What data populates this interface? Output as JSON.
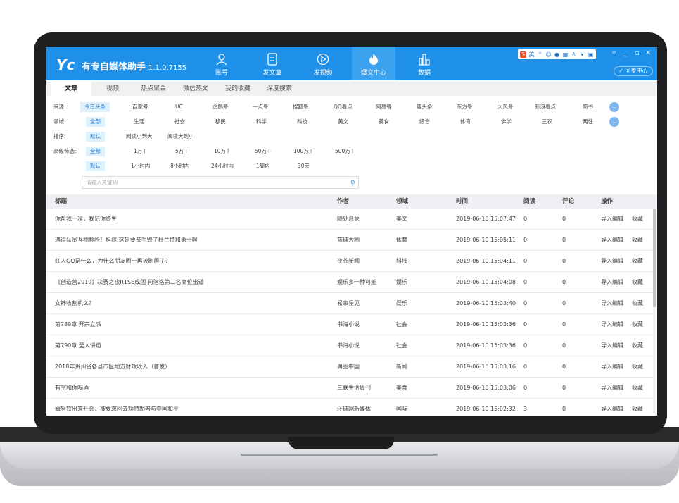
{
  "app": {
    "logo": "Yc",
    "title": "有专自媒体助手",
    "version": "1.1.0.7155",
    "sync_label": "同步中心"
  },
  "nav": [
    {
      "label": "账号",
      "icon": "user-icon"
    },
    {
      "label": "发文章",
      "icon": "document-icon"
    },
    {
      "label": "发视频",
      "icon": "play-icon"
    },
    {
      "label": "爆文中心",
      "icon": "flame-icon",
      "active": true
    },
    {
      "label": "数据",
      "icon": "bar-chart-icon"
    }
  ],
  "toolbar": {
    "ime": "S",
    "ime_mode": "英"
  },
  "tabs": [
    "文章",
    "视频",
    "热点聚合",
    "微信热文",
    "我的收藏",
    "深度搜索"
  ],
  "filters": {
    "source_label": "来源:",
    "sources": [
      "今日头条",
      "百家号",
      "UC",
      "企鹅号",
      "一点号",
      "搜狐号",
      "QQ看点",
      "网易号",
      "趣头条",
      "东方号",
      "大风号",
      "新浪看点",
      "简书"
    ],
    "field_label": "领域:",
    "fields": [
      "全部",
      "生活",
      "社会",
      "移民",
      "科学",
      "科技",
      "美文",
      "美食",
      "综合",
      "体育",
      "佛学",
      "三农",
      "两性"
    ],
    "sort_label": "排序:",
    "sorts": [
      "默认",
      "阅读小到大",
      "阅读大到小"
    ],
    "advanced_label": "高级筛选:",
    "reads": [
      "全部",
      "1万+",
      "5万+",
      "10万+",
      "50万+",
      "100万+",
      "500万+"
    ],
    "times": [
      "默认",
      "1小时内",
      "8小时内",
      "24小时内",
      "1周内",
      "30天"
    ],
    "search_placeholder": "请输入关键词"
  },
  "table": {
    "headers": {
      "title": "标题",
      "author": "作者",
      "field": "领域",
      "time": "时间",
      "reads": "阅读",
      "comments": "评论",
      "actions": "操作"
    },
    "rows": [
      {
        "title": "你帮我一次，我记你终生",
        "author": "随处悬象",
        "field": "美文",
        "time": "2019-06-10 15:07:47",
        "reads": "0",
        "comments": "0"
      },
      {
        "title": "遇得队员互相翻脸！科尔:这是要亲手毁了杜兰特和勇士啊",
        "author": "篮球大圈",
        "field": "体育",
        "time": "2019-06-10 15:05:11",
        "reads": "0",
        "comments": "0"
      },
      {
        "title": "红人GO是什么，为什么朋友圈一再被刷屏了？",
        "author": "夜苍新闻",
        "field": "科技",
        "time": "2019-06-10 15:04:11",
        "reads": "0",
        "comments": "0"
      },
      {
        "title": "《创造营2019》决赛之夜R1SE成团 何洛洛第二名高位出道",
        "author": "娱乐多一种可能",
        "field": "娱乐",
        "time": "2019-06-10 15:04:08",
        "reads": "0",
        "comments": "0"
      },
      {
        "title": "女神收割机么？",
        "author": "易事易见",
        "field": "娱乐",
        "time": "2019-06-10 15:03:40",
        "reads": "0",
        "comments": "0"
      },
      {
        "title": "第789章 开宗立派",
        "author": "书海小说",
        "field": "社会",
        "time": "2019-06-10 15:03:36",
        "reads": "0",
        "comments": "0"
      },
      {
        "title": "第790章 圣人讲道",
        "author": "书海小说",
        "field": "社会",
        "time": "2019-06-10 15:03:36",
        "reads": "0",
        "comments": "0"
      },
      {
        "title": "2018年贵州省各县市区地方财政收入（首发）",
        "author": "舆图中国",
        "field": "新闻",
        "time": "2019-06-10 15:03:16",
        "reads": "0",
        "comments": "0"
      },
      {
        "title": "有空和你喝酒",
        "author": "三联生活周刊",
        "field": "美食",
        "time": "2019-06-10 15:03:06",
        "reads": "0",
        "comments": "0"
      },
      {
        "title": "姆努钦出来开会，被要求回去劝特朗普与中国和平",
        "author": "环球网新媒体",
        "field": "国际",
        "time": "2019-06-10 15:02:32",
        "reads": "3",
        "comments": "0"
      }
    ],
    "action_edit": "导入编辑",
    "action_fav": "收藏"
  }
}
